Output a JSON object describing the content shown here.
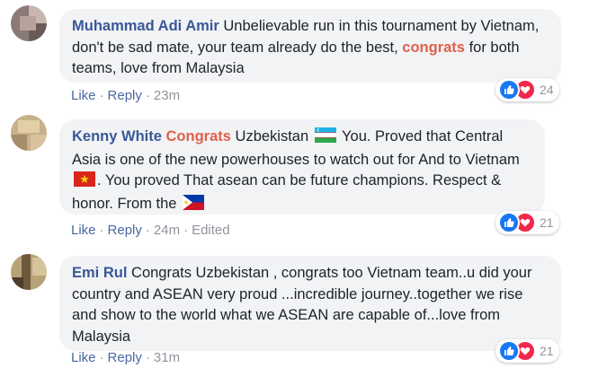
{
  "comments": [
    {
      "author": "Muhammad Adi Amir",
      "text_parts": [
        " Unbelievable run in this tournament by Vietnam, don't be sad mate, your team already do the best, ",
        "congrats",
        " for both teams, love from Malaysia"
      ],
      "actions": {
        "like": "Like",
        "reply": "Reply",
        "time": "23m",
        "edited": ""
      },
      "reaction_count": "24",
      "avatar_colors": [
        "#8a7a78",
        "#c9b6b0",
        "#6a5a58",
        "#b7a39c"
      ]
    },
    {
      "author": "Kenny White",
      "text_parts": [
        " ",
        "Congrats",
        " Uzbekistan ",
        " You. Proved that Central Asia is one of the new powerhouses to watch out for And to Vietnam ",
        ". You proved That asean can be future champions. Respect & honor. From the "
      ],
      "actions": {
        "like": "Like",
        "reply": "Reply",
        "time": "24m",
        "edited": "Edited"
      },
      "reaction_count": "21",
      "avatar_colors": [
        "#c8b08a",
        "#e2cfa8",
        "#a68d6a",
        "#d8c29c"
      ]
    },
    {
      "author": "Emi Rul",
      "text_parts": [
        " Congrats Uzbekistan , congrats too Vietnam team..u did your country and ASEAN very proud ...incredible journey..together we rise and show to the world what we ASEAN are capable of...love from Malaysia"
      ],
      "actions": {
        "like": "Like",
        "reply": "Reply",
        "time": "31m",
        "edited": ""
      },
      "reaction_count": "21",
      "avatar_colors": [
        "#b8a278",
        "#6d5a3c",
        "#d6c49a",
        "#4c3e2a"
      ]
    }
  ],
  "flags": [
    "uzbekistan-flag",
    "vietnam-flag",
    "philippines-flag"
  ],
  "colors": {
    "link": "#385898",
    "highlight": "#e0604b",
    "bubble": "#f2f3f5",
    "meta": "#90949c",
    "like": "#1877f2",
    "love": "#f0284a"
  }
}
